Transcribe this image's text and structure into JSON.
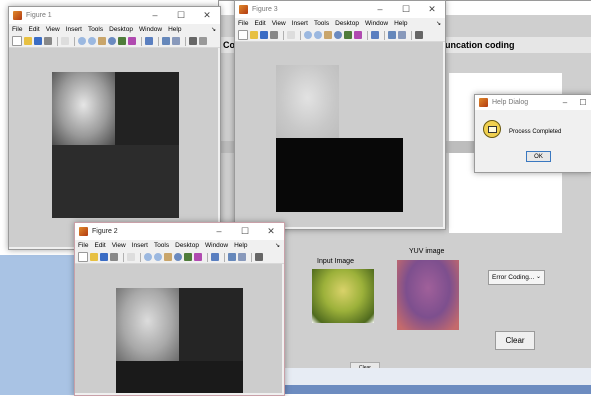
{
  "gui": {
    "title_fragment_left": "Co",
    "title_fragment_right": "ck Truncation coding",
    "input_image_label": "Input Image",
    "yuv_image_label": "YUV image",
    "error_dropdown": "Error Coding...",
    "clear_button": "Clear",
    "clear_button_small": "Clear"
  },
  "figure1": {
    "title": "Figure 1",
    "menu": [
      "File",
      "Edit",
      "View",
      "Insert",
      "Tools",
      "Desktop",
      "Window",
      "Help"
    ],
    "controls": {
      "min": "–",
      "max": "☐",
      "close": "✕"
    }
  },
  "figure3": {
    "title": "Figure 3",
    "menu": [
      "File",
      "Edit",
      "View",
      "Insert",
      "Tools",
      "Desktop",
      "Window",
      "Help"
    ],
    "controls": {
      "min": "–",
      "max": "☐",
      "close": "✕"
    }
  },
  "figure2": {
    "title": "Figure 2",
    "menu": [
      "File",
      "Edit",
      "View",
      "Insert",
      "Tools",
      "Desktop",
      "Window",
      "Help"
    ],
    "controls": {
      "min": "–",
      "max": "☐",
      "close": "✕"
    }
  },
  "help_dialog": {
    "title": "Help Dialog",
    "message": "Process Completed",
    "ok_label": "OK",
    "controls": {
      "min": "–",
      "max": "☐",
      "close": "✕"
    }
  },
  "colors": {
    "matlab_logo": "#d2691e",
    "figure_bg": "#cdcdcd",
    "dark_image": "#0d0d0d"
  }
}
